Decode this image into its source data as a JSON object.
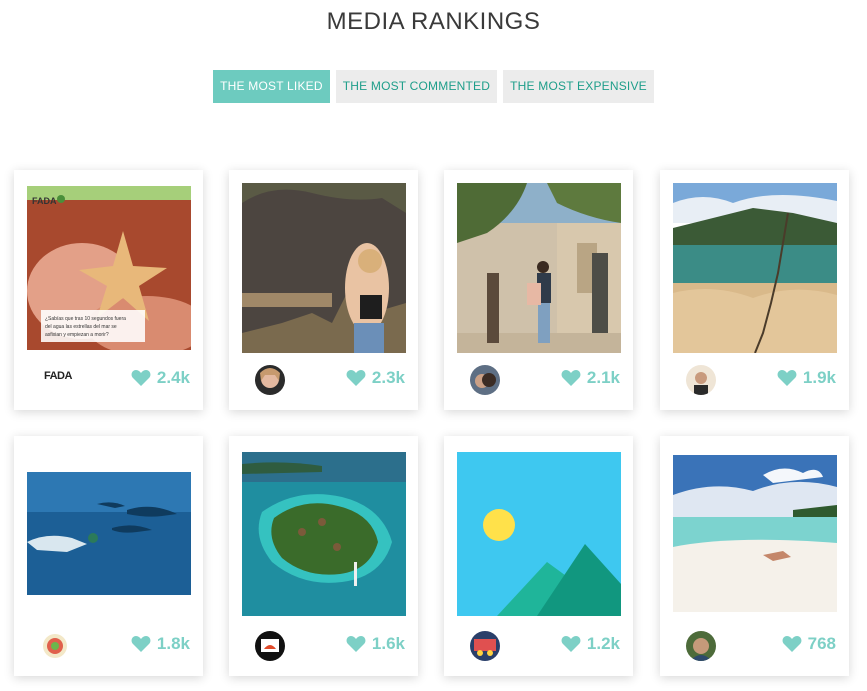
{
  "header": {
    "title": "MEDIA RANKINGS"
  },
  "tabs": [
    {
      "label": "THE MOST LIKED",
      "active": true
    },
    {
      "label": "THE MOST COMMENTED",
      "active": false
    },
    {
      "label": "THE MOST EXPENSIVE",
      "active": false
    }
  ],
  "colors": {
    "accent": "#6dcbbf",
    "heart": "#7dd0c6",
    "tab_inactive_bg": "#ececec",
    "tab_inactive_text": "#1e9e8a"
  },
  "cards": [
    {
      "media": "starfish-infographic",
      "logo_text": "FADA",
      "post_text": "¿Sabías que tras 10 segundos fuera del agua las estrellas del mar se asfixian y empiezan a morir?",
      "likes": "2.4k",
      "icon": "heart-icon"
    },
    {
      "media": "elephant-photo",
      "likes": "2.3k",
      "icon": "heart-icon"
    },
    {
      "media": "couple-photo",
      "likes": "2.1k",
      "icon": "heart-icon"
    },
    {
      "media": "landscape-photo",
      "likes": "1.9k",
      "icon": "heart-icon"
    },
    {
      "media": "dolphin-diver-photo",
      "likes": "1.8k",
      "icon": "heart-icon"
    },
    {
      "media": "island-aerial-photo",
      "likes": "1.6k",
      "icon": "heart-icon"
    },
    {
      "media": "image-placeholder",
      "likes": "1.2k",
      "icon": "heart-icon"
    },
    {
      "media": "beach-photo",
      "likes": "768",
      "icon": "heart-icon"
    }
  ]
}
